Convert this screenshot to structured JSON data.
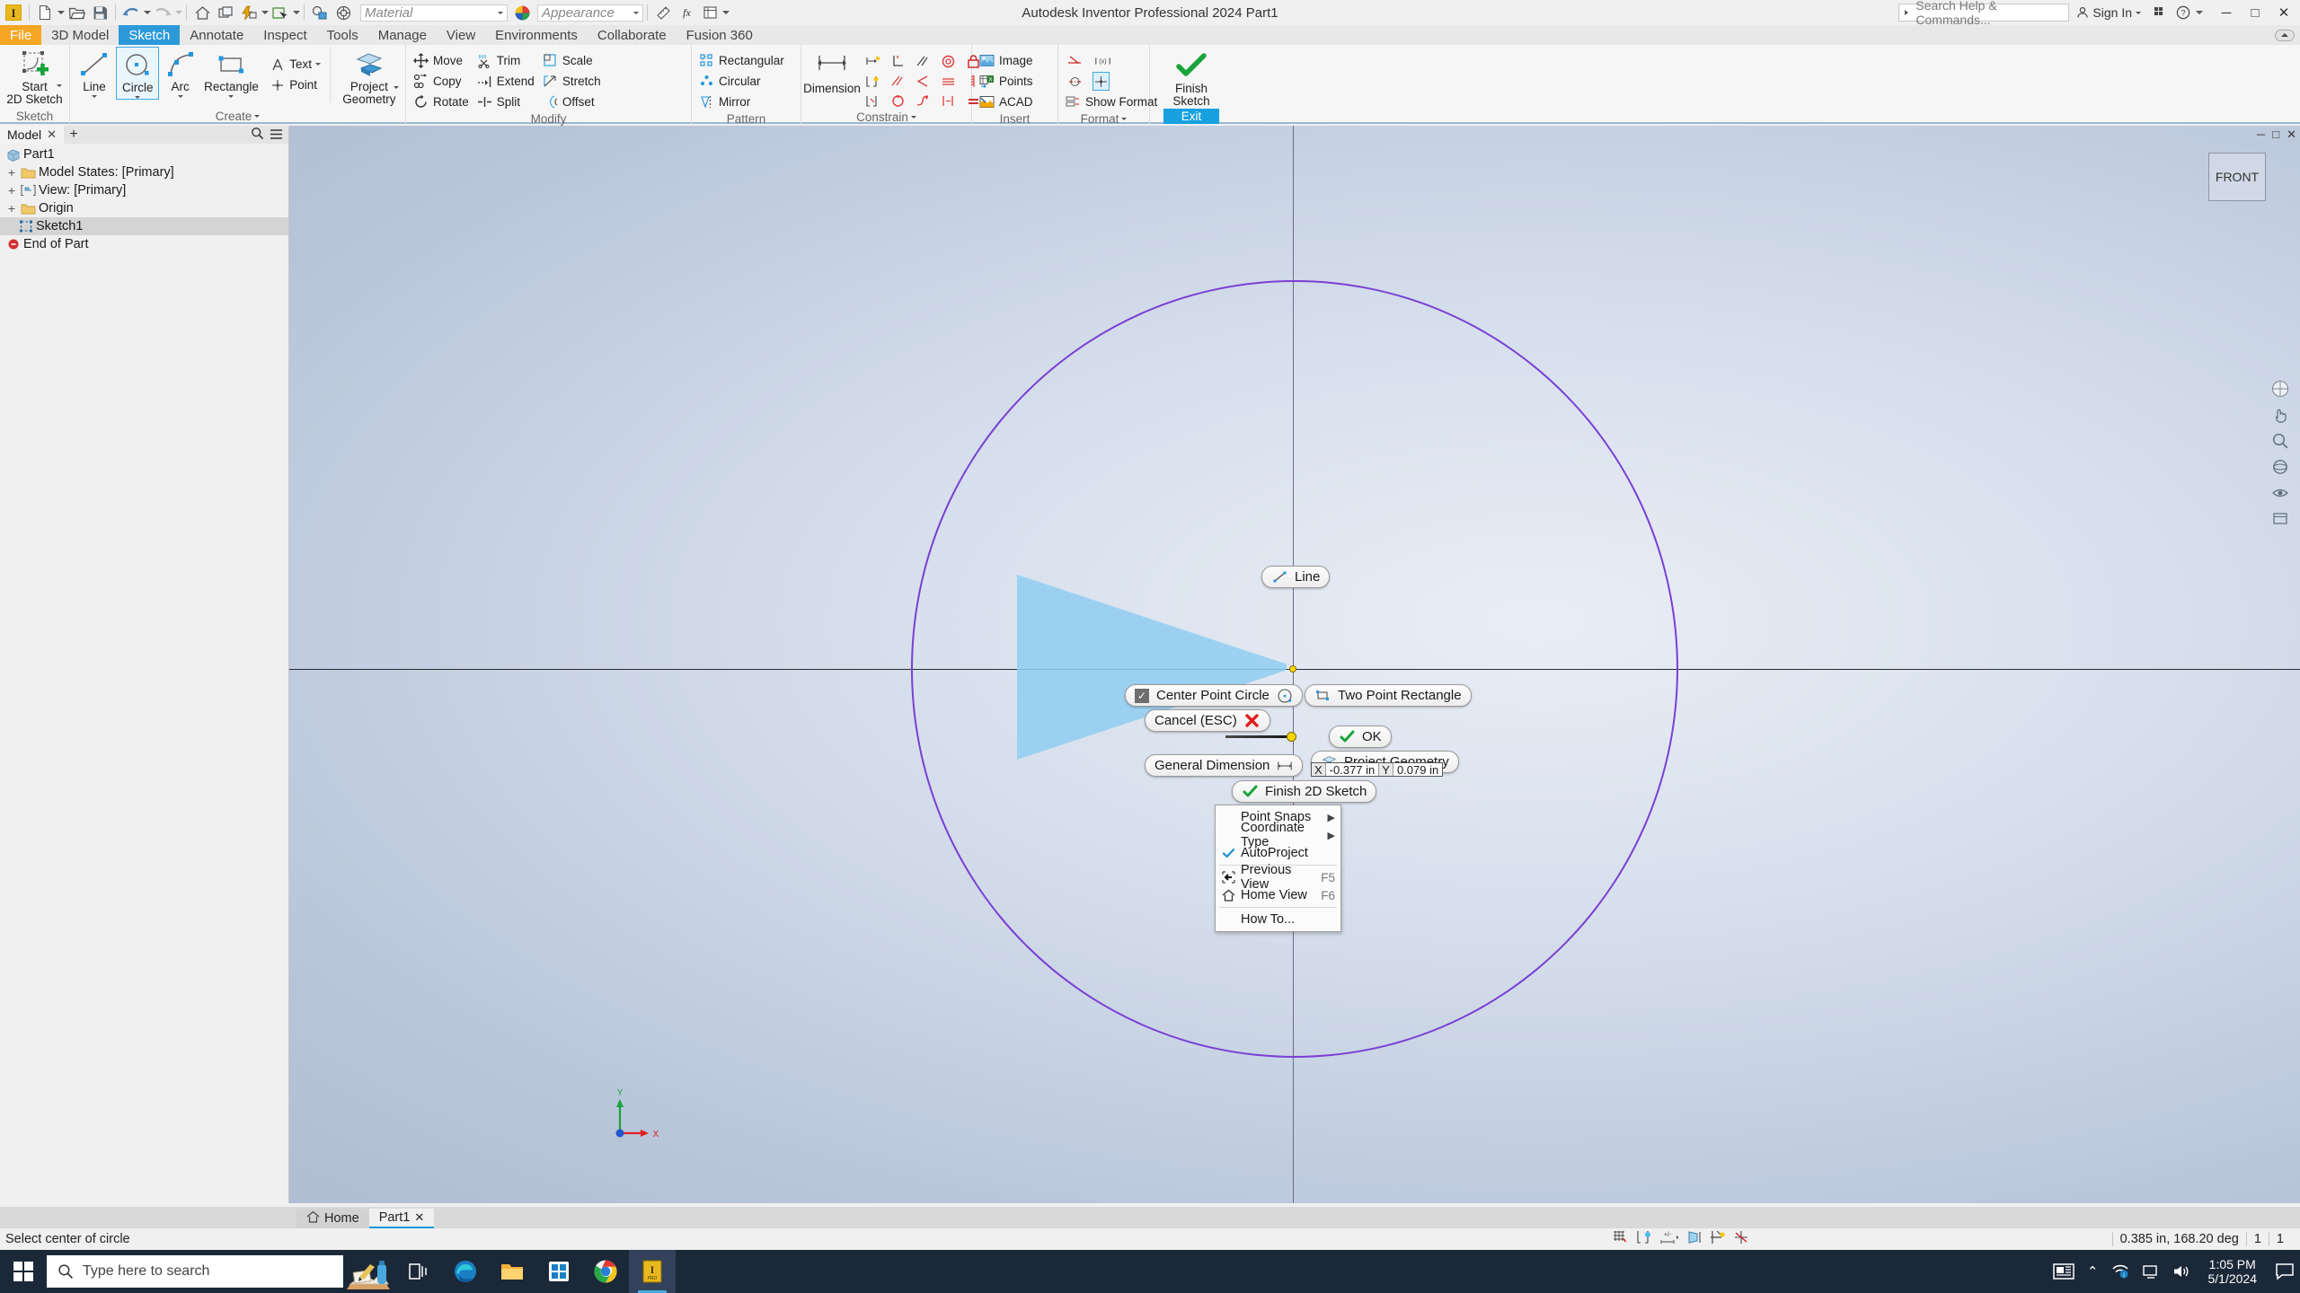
{
  "titlebar": {
    "app_title": "Autodesk Inventor Professional 2024   Part1",
    "material_placeholder": "Material",
    "appearance_placeholder": "Appearance",
    "search_placeholder": "Search Help & Commands...",
    "signin_label": "Sign In",
    "quick_access": [
      {
        "name": "new-icon",
        "label": "New"
      },
      {
        "name": "open-icon",
        "label": "Open"
      },
      {
        "name": "save-icon",
        "label": "Save"
      },
      {
        "name": "undo-icon",
        "label": "Undo"
      },
      {
        "name": "redo-icon",
        "label": "Redo"
      },
      {
        "name": "home-icon",
        "label": "Home"
      },
      {
        "name": "project-icon",
        "label": "Projects"
      },
      {
        "name": "updates-icon",
        "label": "Update"
      },
      {
        "name": "select-icon",
        "label": "Select"
      },
      {
        "name": "appearance-override-icon",
        "label": "Appearance Override"
      },
      {
        "name": "clear-appearance-icon",
        "label": "Clear Appearance"
      }
    ],
    "window_buttons": [
      "minimize",
      "maximize",
      "close"
    ]
  },
  "ribbon": {
    "tabs": [
      {
        "label": "File",
        "state": "file"
      },
      {
        "label": "3D Model",
        "state": "normal"
      },
      {
        "label": "Sketch",
        "state": "active"
      },
      {
        "label": "Annotate",
        "state": "normal"
      },
      {
        "label": "Inspect",
        "state": "normal"
      },
      {
        "label": "Tools",
        "state": "normal"
      },
      {
        "label": "Manage",
        "state": "normal"
      },
      {
        "label": "View",
        "state": "normal"
      },
      {
        "label": "Environments",
        "state": "normal"
      },
      {
        "label": "Collaborate",
        "state": "normal"
      },
      {
        "label": "Fusion 360",
        "state": "normal"
      }
    ],
    "panels": [
      {
        "name": "Sketch",
        "big_buttons": [
          {
            "label": "Start\n2D Sketch",
            "icon": "start-2d-sketch-icon",
            "selected": false,
            "dropdown": true
          }
        ]
      },
      {
        "name": "Create",
        "has_dropdown": true,
        "big_buttons": [
          {
            "label": "Line",
            "icon": "line-icon",
            "selected": false,
            "dropdown": true
          },
          {
            "label": "Circle",
            "icon": "circle-icon",
            "selected": true,
            "dropdown": true
          },
          {
            "label": "Arc",
            "icon": "arc-icon",
            "selected": false,
            "dropdown": true
          },
          {
            "label": "Rectangle",
            "icon": "rectangle-icon",
            "selected": false,
            "dropdown": true
          }
        ],
        "small_buttons": [
          {
            "label": "Text",
            "icon": "text-icon",
            "dropdown": true
          },
          {
            "label": "Point",
            "icon": "point-icon",
            "dropdown": false
          }
        ],
        "big_buttons2": [
          {
            "label": "Project\nGeometry",
            "icon": "project-geometry-icon",
            "selected": false,
            "dropdown": true
          }
        ]
      },
      {
        "name": "Modify",
        "small_buttons": [
          {
            "label": "Move",
            "icon": "move-icon"
          },
          {
            "label": "Copy",
            "icon": "copy-icon"
          },
          {
            "label": "Rotate",
            "icon": "rotate-icon"
          },
          {
            "label": "Trim",
            "icon": "trim-icon"
          },
          {
            "label": "Extend",
            "icon": "extend-icon"
          },
          {
            "label": "Split",
            "icon": "split-icon"
          },
          {
            "label": "Scale",
            "icon": "scale-icon"
          },
          {
            "label": "Stretch",
            "icon": "stretch-icon"
          },
          {
            "label": "Offset",
            "icon": "offset-icon"
          }
        ]
      },
      {
        "name": "Pattern",
        "small_buttons": [
          {
            "label": "Rectangular",
            "icon": "rectangular-pattern-icon"
          },
          {
            "label": "Circular",
            "icon": "circular-pattern-icon"
          },
          {
            "label": "Mirror",
            "icon": "mirror-icon"
          }
        ]
      },
      {
        "name": "Constrain",
        "has_dropdown": true,
        "big_buttons": [
          {
            "label": "Dimension",
            "icon": "dimension-icon",
            "selected": false,
            "dropdown": false
          }
        ],
        "grid_icons": [
          "auto-dimension-icon",
          "perpendicular-icon",
          "parallel-icon",
          "tangent-icon",
          "fix-icon",
          "show-constraints-icon",
          "parallel2-icon",
          "angle-icon",
          "horizontal-icon",
          "vertical-icon",
          "constraint-options-icon",
          "coincident-icon",
          "smooth-icon",
          "symmetric-icon",
          "equal-icon"
        ]
      },
      {
        "name": "Insert",
        "small_buttons": [
          {
            "label": "Image",
            "icon": "image-icon"
          },
          {
            "label": "Points",
            "icon": "points-excel-icon"
          },
          {
            "label": "ACAD",
            "icon": "acad-icon"
          }
        ]
      },
      {
        "name": "Format",
        "has_dropdown": true,
        "small_buttons": [
          {
            "label": "",
            "icon": "construction-line-icon"
          },
          {
            "label": "",
            "icon": "driven-dimension-icon"
          },
          {
            "label": "",
            "icon": "centerline-icon"
          },
          {
            "label": "",
            "icon": "center-point-icon",
            "selected": true
          },
          {
            "label": "Show Format",
            "icon": "show-format-icon"
          }
        ]
      },
      {
        "name": "Exit",
        "exit_style": true,
        "big_buttons": [
          {
            "label": "Finish\nSketch",
            "icon": "finish-sketch-icon",
            "selected": false,
            "dropdown": false
          }
        ]
      }
    ]
  },
  "browser": {
    "tab_label": "Model",
    "close_glyph": "✕",
    "add_glyph": "+",
    "search_icon": "search-icon",
    "menu_icon": "hamburger-icon",
    "tree": [
      {
        "label": "Part1",
        "icon": "part-icon",
        "indent": 0,
        "expander": "",
        "selected": false
      },
      {
        "label": "Model States: [Primary]",
        "icon": "folder-icon",
        "indent": 1,
        "expander": "+",
        "selected": false
      },
      {
        "label": "View: [Primary]",
        "icon": "view-icon",
        "indent": 1,
        "expander": "+",
        "selected": false
      },
      {
        "label": "Origin",
        "icon": "folder-icon",
        "indent": 1,
        "expander": "+",
        "selected": false
      },
      {
        "label": "Sketch1",
        "icon": "sketch-icon",
        "indent": 1,
        "expander": "",
        "selected": true
      },
      {
        "label": "End of Part",
        "icon": "end-of-part-icon",
        "indent": 0,
        "expander": "",
        "selected": false
      }
    ]
  },
  "canvas": {
    "viewcube_label": "FRONT",
    "window_buttons": [
      "minimize",
      "maximize",
      "close"
    ],
    "triad": {
      "x_label": "X",
      "y_label": "Y"
    },
    "coord_hud": {
      "x_label": "X",
      "x_value": "-0.377 in",
      "y_label": "Y",
      "y_value": "0.079 in"
    }
  },
  "marking_menu": {
    "items": [
      {
        "id": "line",
        "label": "Line",
        "icon": "line-icon",
        "checked": false,
        "pos": "top"
      },
      {
        "id": "two-point-rectangle",
        "label": "Two Point Rectangle",
        "icon": "rectangle-icon",
        "checked": false,
        "pos": "right-top"
      },
      {
        "id": "center-point-circle",
        "label": "Center Point Circle",
        "icon": "circle-icon",
        "checked": true,
        "pos": "left-top"
      },
      {
        "id": "cancel",
        "label": "Cancel (ESC)",
        "icon": "cancel-icon",
        "checked": false,
        "pos": "left"
      },
      {
        "id": "ok",
        "label": "OK",
        "icon": "ok-check-icon",
        "checked": false,
        "pos": "right"
      },
      {
        "id": "general-dimension",
        "label": "General Dimension",
        "icon": "dimension-icon",
        "checked": false,
        "pos": "left-bottom"
      },
      {
        "id": "project-geometry",
        "label": "Project Geometry",
        "icon": "project-geometry-icon",
        "checked": false,
        "pos": "right-bottom"
      },
      {
        "id": "finish-2d-sketch",
        "label": "Finish 2D Sketch",
        "icon": "ok-check-icon",
        "checked": false,
        "pos": "bottom"
      }
    ]
  },
  "context_menu": {
    "items": [
      {
        "label": "Point Snaps",
        "icon": "",
        "shortcut": "",
        "submenu": true,
        "checked": false,
        "sep_after": false
      },
      {
        "label": "Coordinate Type",
        "icon": "",
        "shortcut": "",
        "submenu": true,
        "checked": false,
        "sep_after": false
      },
      {
        "label": "AutoProject",
        "icon": "",
        "shortcut": "",
        "submenu": false,
        "checked": true,
        "sep_after": true
      },
      {
        "label": "Previous View",
        "icon": "previous-view-icon",
        "shortcut": "F5",
        "submenu": false,
        "checked": false,
        "sep_after": false
      },
      {
        "label": "Home View",
        "icon": "home-view-icon",
        "shortcut": "F6",
        "submenu": false,
        "checked": false,
        "sep_after": true
      },
      {
        "label": "How To...",
        "icon": "",
        "shortcut": "",
        "submenu": false,
        "checked": false,
        "sep_after": false
      }
    ]
  },
  "doc_tabs": [
    {
      "label": "Home",
      "icon": "home-icon",
      "active": false,
      "closable": false
    },
    {
      "label": "Part1",
      "icon": "",
      "active": true,
      "closable": true
    }
  ],
  "statusbar": {
    "prompt": "Select center of circle",
    "tool_icons": [
      "grid-snap-icon",
      "constraint-infer-icon",
      "dim-input-icon",
      "slice-graphics-icon",
      "show-constraints-icon",
      "show-degrees-icon"
    ],
    "measurement": "0.385 in, 168.20 deg",
    "count1": "1",
    "count2": "1"
  },
  "taskbar": {
    "search_placeholder": "Type here to search",
    "apps": [
      {
        "name": "task-view-icon",
        "active": false
      },
      {
        "name": "edge-icon",
        "active": false
      },
      {
        "name": "file-explorer-icon",
        "active": false
      },
      {
        "name": "microsoft-store-icon",
        "active": false
      },
      {
        "name": "chrome-icon",
        "active": false
      },
      {
        "name": "inventor-icon",
        "active": true
      }
    ],
    "tray": {
      "news_icon": "news-weather-icon",
      "chevron": "⌃",
      "network_icon": "network-icon",
      "display_icon": "display-icon",
      "volume_icon": "volume-icon",
      "time": "1:05 PM",
      "date": "5/1/2024",
      "notification_icon": "notification-icon"
    }
  },
  "colors": {
    "accent_blue": "#1a9ad9",
    "file_orange": "#f5a623",
    "sketch_purple": "#7a3fd4",
    "origin_yellow": "#ffd400",
    "marking_highlight": "#8fcdf0"
  }
}
